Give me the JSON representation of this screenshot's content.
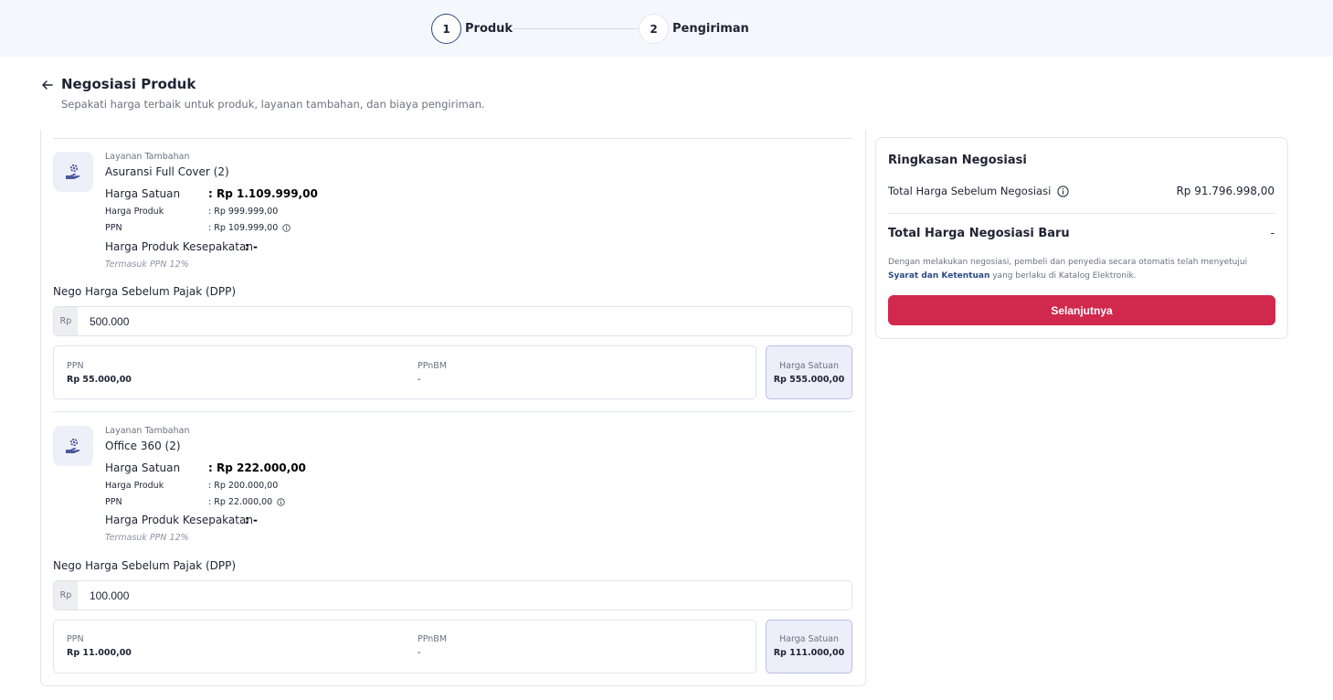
{
  "stepper": {
    "steps": [
      {
        "number": "1",
        "label": "Produk",
        "active": true
      },
      {
        "number": "2",
        "label": "Pengiriman",
        "active": false
      }
    ]
  },
  "header": {
    "title": "Negosiasi Produk",
    "subtitle": "Sepakati harga terbaik untuk produk, layanan tambahan, dan biaya pengiriman."
  },
  "items": [
    {
      "category": "Layanan Tambahan",
      "name": "Asuransi Full Cover (2)",
      "unit_price_label": "Harga Satuan",
      "unit_price_value": ": Rp 1.109.999,00",
      "product_price_label": "Harga Produk",
      "product_price_value": ": Rp 999.999,00",
      "ppn_label": "PPN",
      "ppn_value": ": Rp 109.999,00",
      "agreed_label": "Harga Produk Kesepakatan",
      "agreed_value": ": -",
      "incl_note": "Termasuk PPN 12%",
      "nego_label": "Nego Harga Sebelum Pajak (DPP)",
      "input_prefix": "Rp",
      "input_value": "500.000",
      "tax_ppn_label": "PPN",
      "tax_ppn_value": "Rp 55.000,00",
      "tax_ppnbm_label": "PPnBM",
      "tax_ppnbm_value": "-",
      "unit_box_label": "Harga Satuan",
      "unit_box_value": "Rp 555.000,00"
    },
    {
      "category": "Layanan Tambahan",
      "name": "Office 360 (2)",
      "unit_price_label": "Harga Satuan",
      "unit_price_value": ": Rp 222.000,00",
      "product_price_label": "Harga Produk",
      "product_price_value": ": Rp 200.000,00",
      "ppn_label": "PPN",
      "ppn_value": ": Rp 22.000,00",
      "agreed_label": "Harga Produk Kesepakatan",
      "agreed_value": ": -",
      "incl_note": "Termasuk PPN 12%",
      "nego_label": "Nego Harga Sebelum Pajak (DPP)",
      "input_prefix": "Rp",
      "input_value": "100.000",
      "tax_ppn_label": "PPN",
      "tax_ppn_value": "Rp 11.000,00",
      "tax_ppnbm_label": "PPnBM",
      "tax_ppnbm_value": "-",
      "unit_box_label": "Harga Satuan",
      "unit_box_value": "Rp 111.000,00"
    }
  ],
  "summary": {
    "title": "Ringkasan Negosiasi",
    "before_label": "Total Harga Sebelum Negosiasi",
    "before_value": "Rp 91.796.998,00",
    "new_label": "Total Harga Negosiasi Baru",
    "new_value": "-",
    "note_prefix": "Dengan melakukan negosiasi, pembeli dan penyedia secara otomatis telah menyetujui",
    "note_link": "Syarat dan Ketentuan",
    "note_suffix": "yang berlaku di Katalog Elektronik.",
    "next_label": "Selanjutnya"
  },
  "colors": {
    "primary_button": "#d1294e",
    "link": "#2b4c86",
    "stepper_bg": "#f4f7fb",
    "unit_box_bg": "#eceefa"
  },
  "icons": {
    "back": "arrow-left-icon",
    "service": "hand-gear-icon",
    "info": "info-icon"
  }
}
